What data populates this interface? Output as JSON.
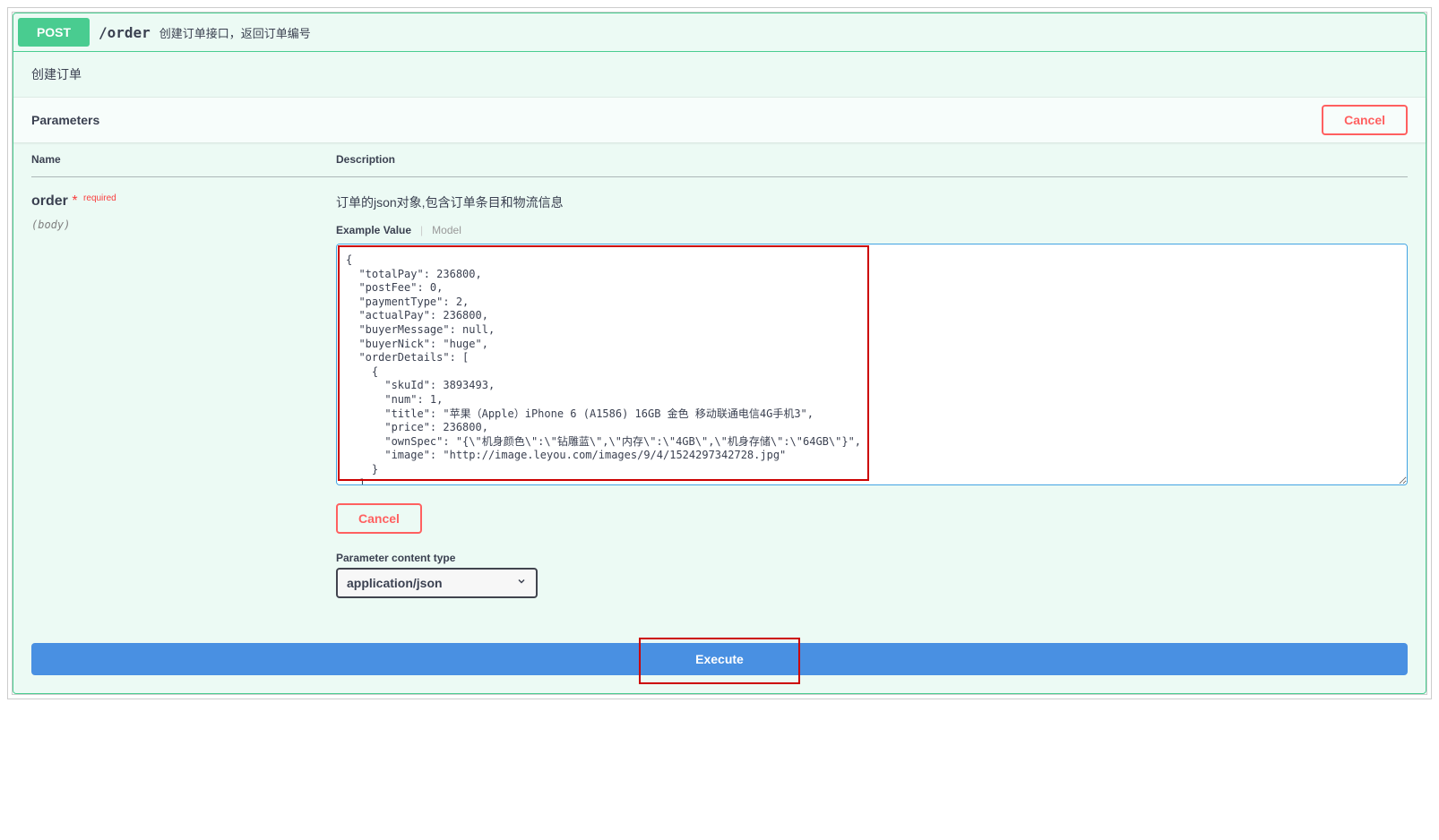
{
  "summary": {
    "method": "POST",
    "path": "/order",
    "description": "创建订单接口，返回订单编号"
  },
  "opblock": {
    "description": "创建订单"
  },
  "parameters": {
    "section_title": "Parameters",
    "cancel_label": "Cancel",
    "headers": {
      "name": "Name",
      "description": "Description"
    },
    "row": {
      "name": "order",
      "required_label": "required",
      "in_label": "(body)",
      "description": "订单的json对象,包含订单条目和物流信息",
      "tabs": {
        "example_value": "Example Value",
        "model": "Model"
      },
      "body": "{\n  \"totalPay\": 236800,\n  \"postFee\": 0,\n  \"paymentType\": 2,\n  \"actualPay\": 236800,\n  \"buyerMessage\": null,\n  \"buyerNick\": \"huge\",\n  \"orderDetails\": [\n    {\n      \"skuId\": 3893493,\n      \"num\": 1,\n      \"title\": \"苹果（Apple）iPhone 6 (A1586) 16GB 金色 移动联通电信4G手机3\",\n      \"price\": 236800,\n      \"ownSpec\": \"{\\\"机身颜色\\\":\\\"钻雕蓝\\\",\\\"内存\\\":\\\"4GB\\\",\\\"机身存储\\\":\\\"64GB\\\"}\",\n      \"image\": \"http://image.leyou.com/images/9/4/1524297342728.jpg\"\n    }\n  ],",
      "cancel_label": "Cancel",
      "content_type_label": "Parameter content type",
      "content_type_value": "application/json"
    }
  },
  "execute": {
    "label": "Execute"
  }
}
